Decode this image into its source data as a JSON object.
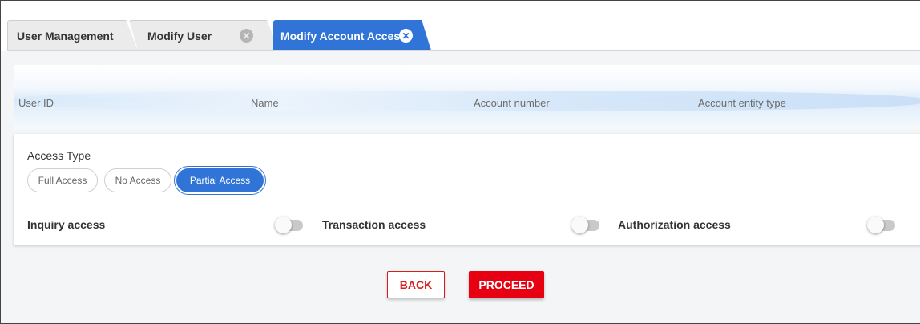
{
  "tabs": [
    {
      "label": "User Management",
      "active": false,
      "closable": false
    },
    {
      "label": "Modify User",
      "active": false,
      "closable": true
    },
    {
      "label": "Modify Account Access",
      "active": true,
      "closable": true
    }
  ],
  "info_header": {
    "columns": [
      "User ID",
      "Name",
      "Account number",
      "Account entity type"
    ]
  },
  "access": {
    "title": "Access Type",
    "options": [
      "Full Access",
      "No Access",
      "Partial Access"
    ],
    "selected": "Partial Access"
  },
  "permissions": [
    {
      "label": "Inquiry access",
      "enabled": false
    },
    {
      "label": "Transaction access",
      "enabled": false
    },
    {
      "label": "Authorization access",
      "enabled": false
    }
  ],
  "actions": {
    "back_label": "BACK",
    "proceed_label": "PROCEED"
  },
  "colors": {
    "accent_blue": "#2f74d6",
    "action_red": "#e60012",
    "background": "#f4f5f7"
  },
  "icons": {
    "tab_close": "close-circle-icon"
  }
}
